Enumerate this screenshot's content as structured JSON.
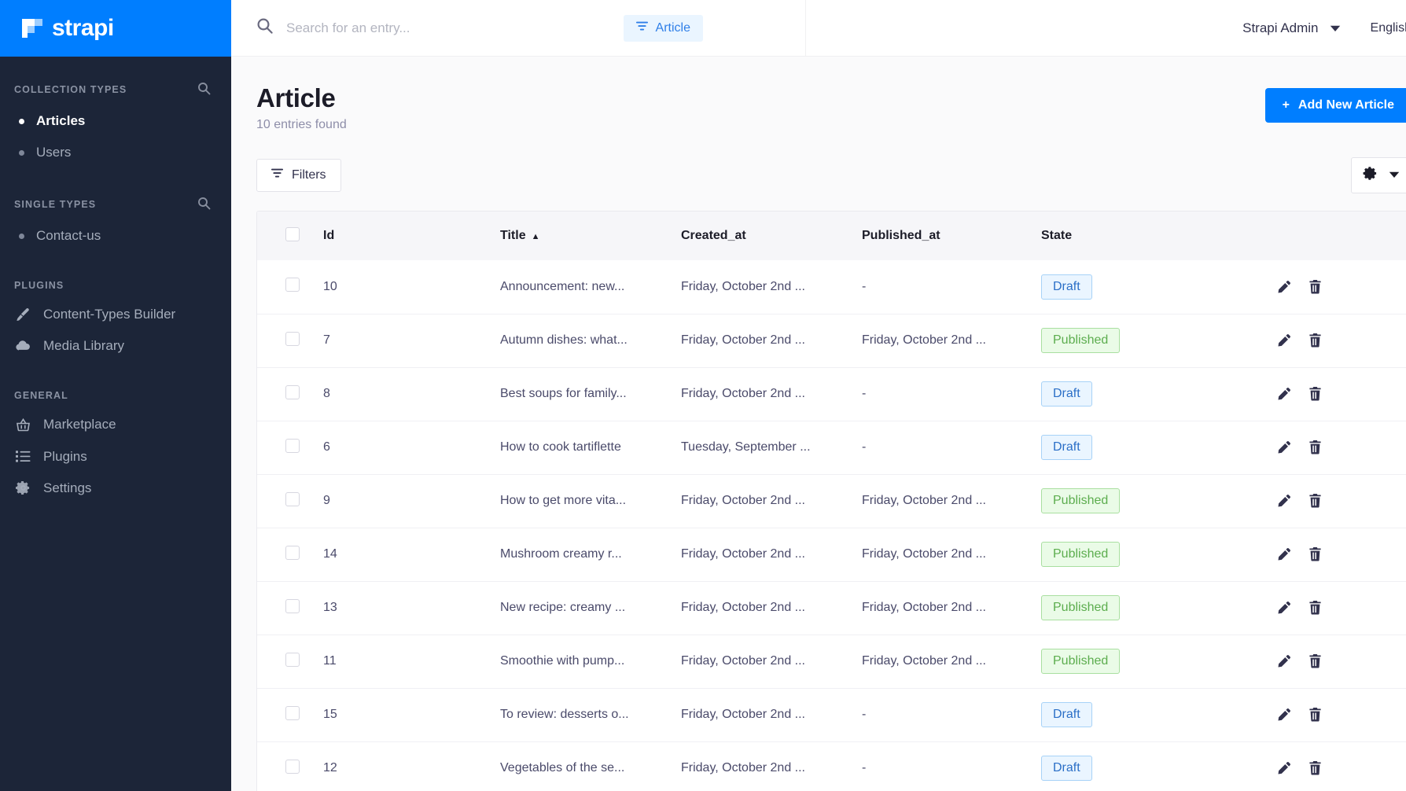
{
  "brand": {
    "name": "strapi",
    "color": "#007eff"
  },
  "sidebar": {
    "sections": [
      {
        "title": "COLLECTION TYPES",
        "has_search": true,
        "items": [
          {
            "label": "Articles",
            "icon": "bullet-icon",
            "active": true
          },
          {
            "label": "Users",
            "icon": "bullet-icon",
            "active": false
          }
        ]
      },
      {
        "title": "SINGLE TYPES",
        "has_search": true,
        "items": [
          {
            "label": "Contact-us",
            "icon": "bullet-icon",
            "active": false
          }
        ]
      },
      {
        "title": "PLUGINS",
        "has_search": false,
        "items": [
          {
            "label": "Content-Types Builder",
            "icon": "paintbrush-icon",
            "active": false
          },
          {
            "label": "Media Library",
            "icon": "cloud-upload-icon",
            "active": false
          }
        ]
      },
      {
        "title": "GENERAL",
        "has_search": false,
        "items": [
          {
            "label": "Marketplace",
            "icon": "shopping-basket-icon",
            "active": false
          },
          {
            "label": "Plugins",
            "icon": "list-icon",
            "active": false
          },
          {
            "label": "Settings",
            "icon": "gear-icon",
            "active": false
          }
        ]
      }
    ]
  },
  "topbar": {
    "search": {
      "value": "",
      "placeholder": "Search for an entry..."
    },
    "filter_chip": "Article",
    "user": "Strapi Admin",
    "language": "English"
  },
  "page": {
    "title": "Article",
    "subtitle": "10 entries found",
    "add_button": "Add New Article",
    "add_button_plus": "+",
    "filters_button": "Filters"
  },
  "table": {
    "columns": [
      "Id",
      "Title",
      "Created_at",
      "Published_at",
      "State"
    ],
    "sorted_column": "Title",
    "sort_direction": "asc",
    "sort_glyph": "▲",
    "rows": [
      {
        "id": "10",
        "title": "Announcement: new...",
        "created_at": "Friday, October 2nd ...",
        "published_at": "-",
        "state": "Draft"
      },
      {
        "id": "7",
        "title": "Autumn dishes: what...",
        "created_at": "Friday, October 2nd ...",
        "published_at": "Friday, October 2nd ...",
        "state": "Published"
      },
      {
        "id": "8",
        "title": "Best soups for family...",
        "created_at": "Friday, October 2nd ...",
        "published_at": "-",
        "state": "Draft"
      },
      {
        "id": "6",
        "title": "How to cook tartiflette",
        "created_at": "Tuesday, September ...",
        "published_at": "-",
        "state": "Draft"
      },
      {
        "id": "9",
        "title": "How to get more vita...",
        "created_at": "Friday, October 2nd ...",
        "published_at": "Friday, October 2nd ...",
        "state": "Published"
      },
      {
        "id": "14",
        "title": "Mushroom creamy r...",
        "created_at": "Friday, October 2nd ...",
        "published_at": "Friday, October 2nd ...",
        "state": "Published"
      },
      {
        "id": "13",
        "title": "New recipe: creamy ...",
        "created_at": "Friday, October 2nd ...",
        "published_at": "Friday, October 2nd ...",
        "state": "Published"
      },
      {
        "id": "11",
        "title": "Smoothie with pump...",
        "created_at": "Friday, October 2nd ...",
        "published_at": "Friday, October 2nd ...",
        "state": "Published"
      },
      {
        "id": "15",
        "title": "To review: desserts o...",
        "created_at": "Friday, October 2nd ...",
        "published_at": "-",
        "state": "Draft"
      },
      {
        "id": "12",
        "title": "Vegetables of the se...",
        "created_at": "Friday, October 2nd ...",
        "published_at": "-",
        "state": "Draft"
      }
    ]
  },
  "colors": {
    "brand_blue": "#007eff",
    "sidebar_bg": "#1c2538",
    "draft_bg": "#eaf5ff",
    "draft_text": "#2b6fc7",
    "published_bg": "#eafbe7",
    "published_text": "#5cad4e"
  }
}
